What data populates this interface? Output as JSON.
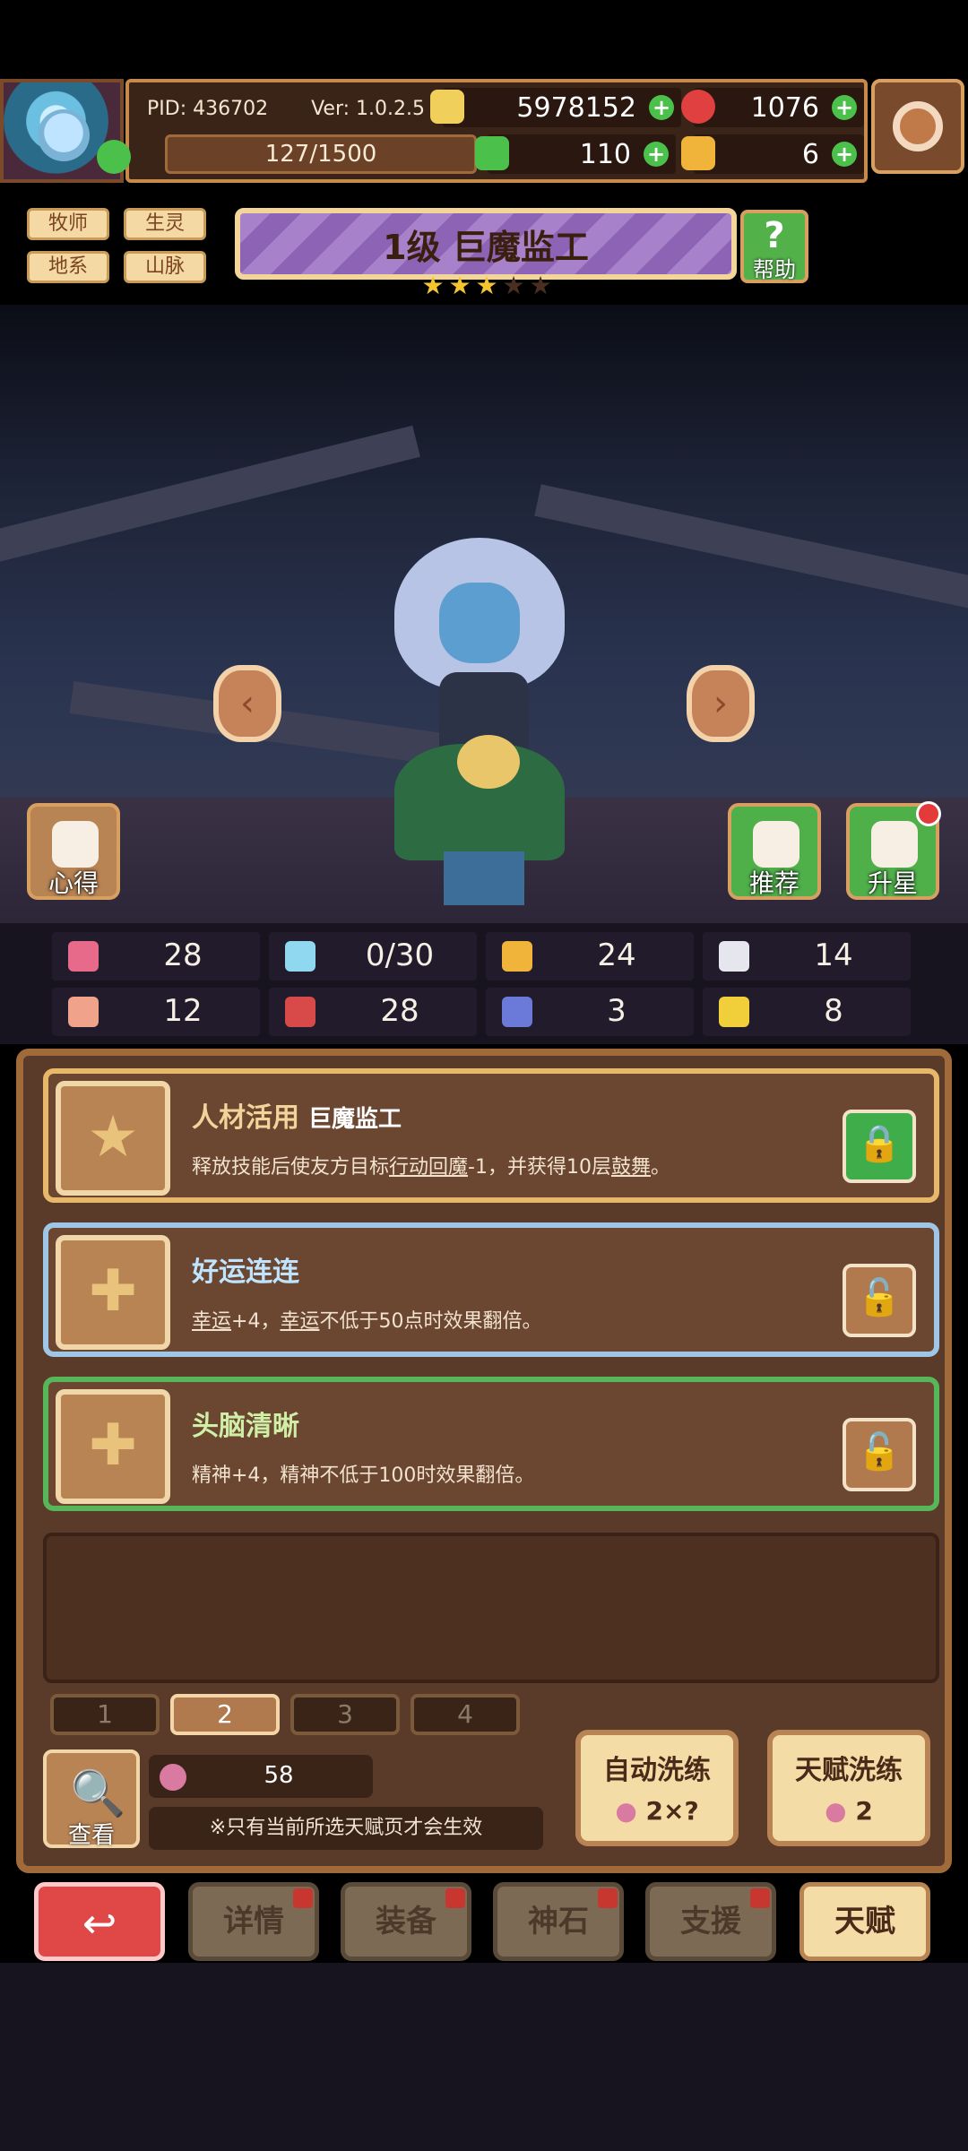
{
  "header": {
    "pid": "PID: 436702",
    "version": "Ver: 1.0.2.5",
    "gold": "5978152",
    "gems": "1076",
    "stamina": "127/1500",
    "clover": "110",
    "key": "6"
  },
  "tags": [
    "牧师",
    "生灵",
    "地系",
    "山脉"
  ],
  "title": {
    "level_name": "1级  巨魔监工",
    "help_label": "帮助",
    "stars_filled": 3,
    "stars_total": 5
  },
  "scene": {
    "notes_label": "心得",
    "recommend_label": "推荐",
    "upgrade_star_label": "升星"
  },
  "stats": {
    "hp": "28",
    "mp": "0/30",
    "defense": "24",
    "speed": "14",
    "strength": "12",
    "intellect": "28",
    "stat7": "3",
    "stat8": "8"
  },
  "talents": [
    {
      "name": "人材活用",
      "subtitle": "巨魔监工",
      "desc_parts": [
        "释放技能后使友方目标",
        "行动回魔",
        "-1，并获得10层",
        "鼓舞",
        "。"
      ],
      "locked": true
    },
    {
      "name": "好运连连",
      "desc_parts": [
        "幸运",
        "+4，",
        "幸运",
        "不低于50点时效果翻倍。"
      ],
      "locked": false
    },
    {
      "name": "头脑清晰",
      "desc": "精神+4，精神不低于100时效果翻倍。",
      "locked": false
    }
  ],
  "pages": [
    "1",
    "2",
    "3",
    "4"
  ],
  "active_page": "2",
  "bottom": {
    "seeds": "58",
    "note": "※只有当前所选天赋页才会生效",
    "view_label": "查看",
    "auto_reroll_label": "自动洗练",
    "auto_reroll_cost": "2×?",
    "talent_reroll_label": "天赋洗练",
    "talent_reroll_cost": "2"
  },
  "nav": {
    "details": "详情",
    "equipment": "装备",
    "godstone": "神石",
    "support": "支援",
    "talent": "天赋"
  },
  "colors": {
    "gold_border": "#e7b86a",
    "blue_border": "#9fc6e6",
    "green_border": "#58b65a",
    "panel_bg": "#5a3a28",
    "back_red": "#e04848"
  }
}
